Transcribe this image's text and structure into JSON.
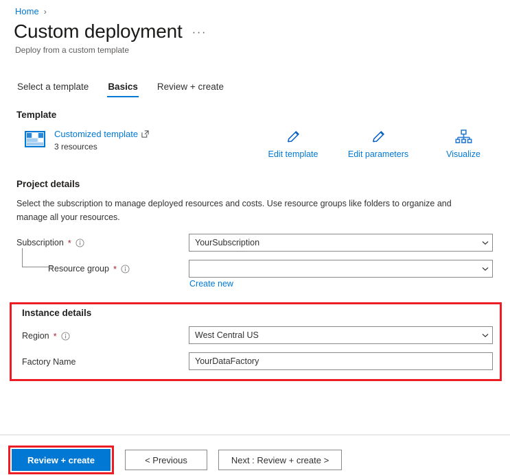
{
  "breadcrumb": {
    "home": "Home",
    "separator": "›"
  },
  "header": {
    "title": "Custom deployment",
    "subtitle": "Deploy from a custom template",
    "more_label": "···"
  },
  "tabs": [
    {
      "label": "Select a template",
      "active": false
    },
    {
      "label": "Basics",
      "active": true
    },
    {
      "label": "Review + create",
      "active": false
    }
  ],
  "template": {
    "heading": "Template",
    "link_label": "Customized template",
    "resources_label": "3 resources",
    "actions": [
      {
        "label": "Edit template",
        "icon": "pencil-icon"
      },
      {
        "label": "Edit parameters",
        "icon": "pencil-icon"
      },
      {
        "label": "Visualize",
        "icon": "hierarchy-icon"
      }
    ]
  },
  "project_details": {
    "heading": "Project details",
    "description": "Select the subscription to manage deployed resources and costs. Use resource groups like folders to organize and manage all your resources.",
    "subscription": {
      "label": "Subscription",
      "required": "*",
      "value": "YourSubscription"
    },
    "resource_group": {
      "label": "Resource group",
      "required": "*",
      "value": "",
      "create_new": "Create new"
    }
  },
  "instance_details": {
    "heading": "Instance details",
    "region": {
      "label": "Region",
      "required": "*",
      "value": "West Central US"
    },
    "factory_name": {
      "label": "Factory Name",
      "value": "YourDataFactory"
    }
  },
  "footer": {
    "review_create": "Review + create",
    "previous": "< Previous",
    "next": "Next : Review + create >"
  },
  "colors": {
    "accent": "#0078d4",
    "highlight": "#ec1c24",
    "required": "#a4262c",
    "border": "#8a8886",
    "text": "#323130"
  }
}
